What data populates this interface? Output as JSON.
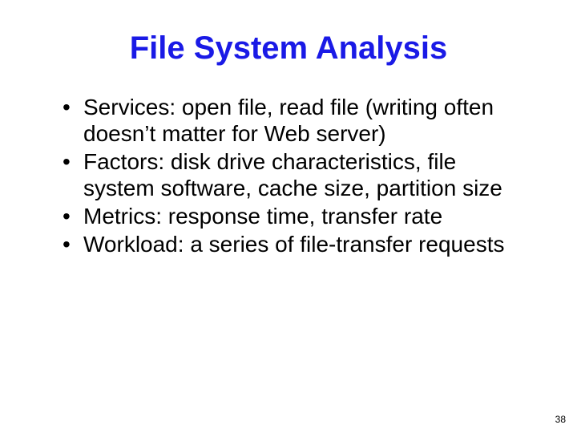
{
  "slide": {
    "title": "File System Analysis",
    "bullets": [
      "Services: open file, read file (writing often doesn’t matter for Web server)",
      "Factors: disk drive characteristics, file system software, cache size, partition size",
      "Metrics: response time, transfer rate",
      "Workload: a series of file-transfer requests"
    ],
    "page_number": "38"
  }
}
